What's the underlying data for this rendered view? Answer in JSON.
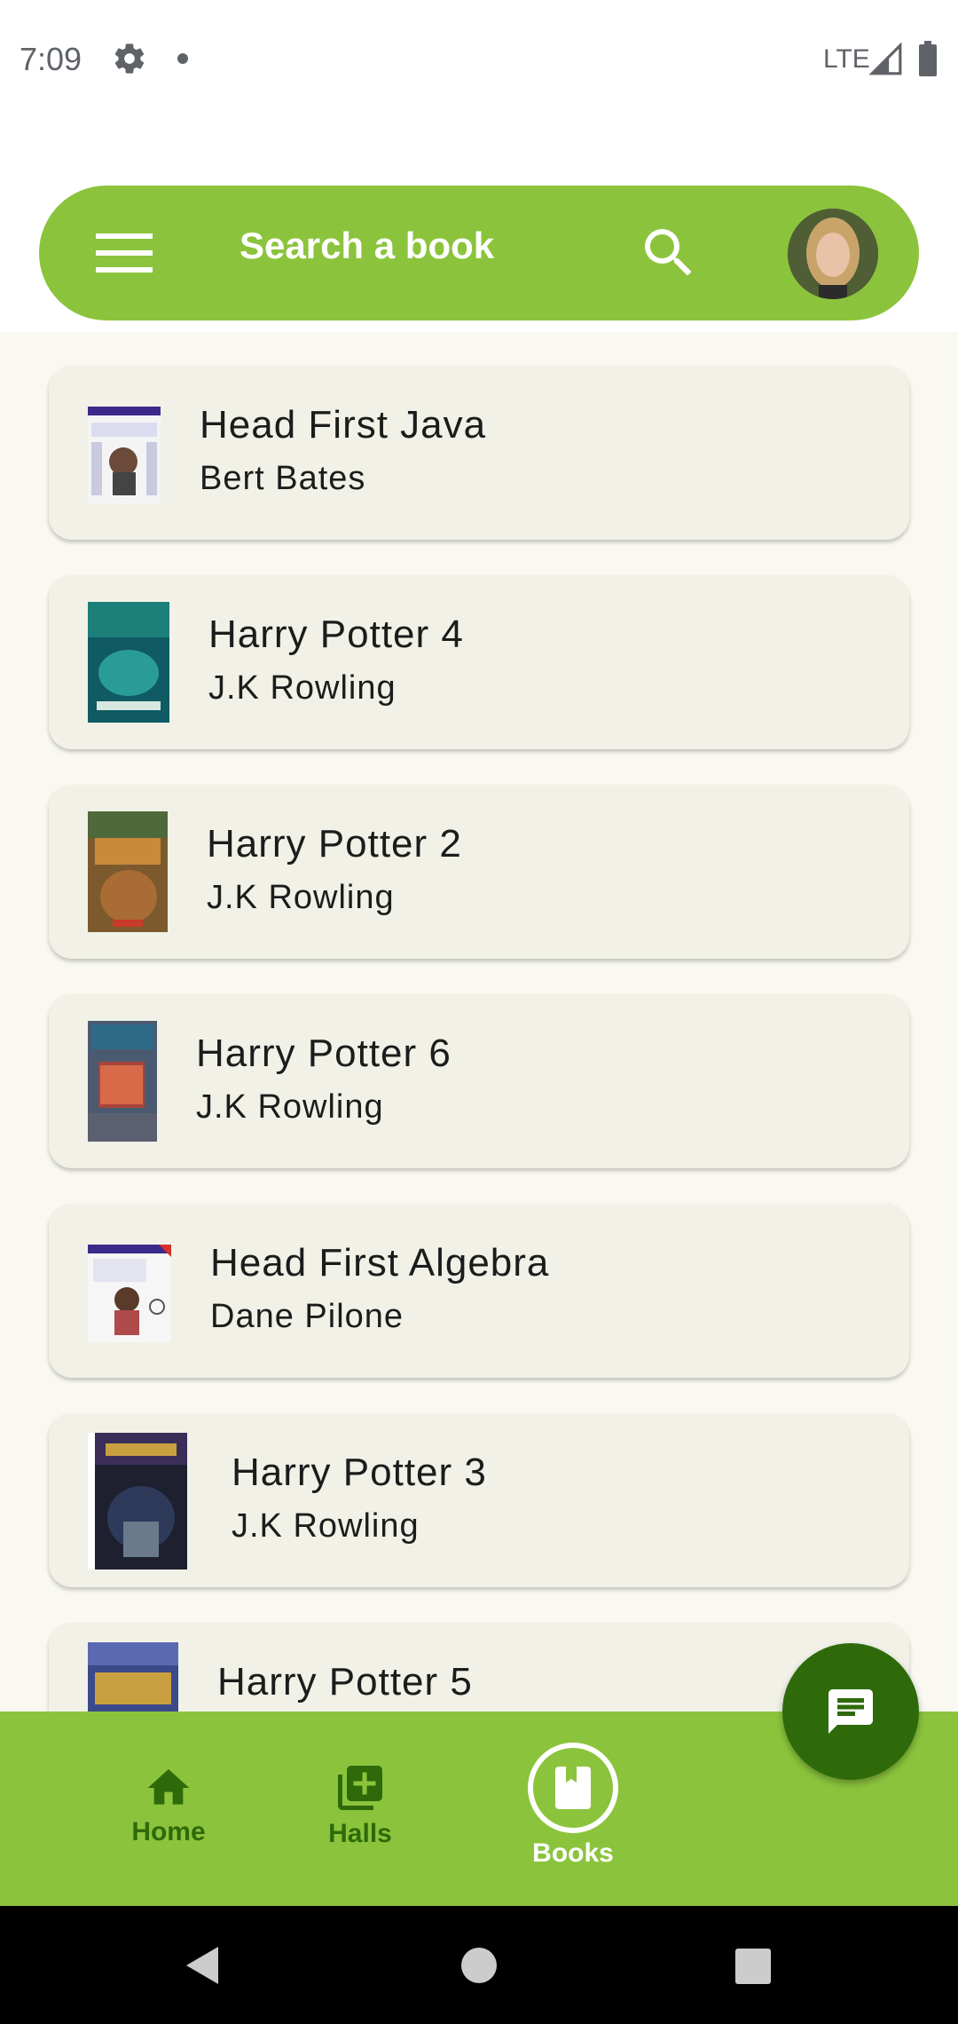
{
  "status_bar": {
    "time": "7:09",
    "network": "LTE",
    "icons": [
      "gear-icon",
      "notification-dot-icon",
      "signal-icon",
      "battery-icon"
    ]
  },
  "search": {
    "placeholder": "Search a book",
    "icons": [
      "menu-icon",
      "search-icon"
    ]
  },
  "books": [
    {
      "title": "Head First Java",
      "author": "Bert Bates"
    },
    {
      "title": "Harry Potter 4",
      "author": "J.K Rowling"
    },
    {
      "title": "Harry Potter 2",
      "author": "J.K Rowling"
    },
    {
      "title": "Harry Potter 6",
      "author": "J.K Rowling"
    },
    {
      "title": "Head First Algebra",
      "author": "Dane Pilone"
    },
    {
      "title": "Harry Potter 3",
      "author": "J.K Rowling"
    },
    {
      "title": "Harry Potter 5",
      "author": ""
    }
  ],
  "bottom_nav": {
    "items": [
      {
        "label": "Home",
        "icon": "home-icon",
        "selected": false
      },
      {
        "label": "Halls",
        "icon": "add-library-icon",
        "selected": false
      },
      {
        "label": "Books",
        "icon": "book-icon",
        "selected": true
      }
    ]
  },
  "fab": {
    "icon": "message-icon"
  },
  "system_nav": {
    "icons": [
      "back-icon",
      "home-circle-icon",
      "recents-icon"
    ]
  },
  "colors": {
    "accent": "#8bc43c",
    "accent_dark": "#2f6a0a",
    "card_bg": "#f1f1e8",
    "page_bg": "#f9f9f1"
  }
}
